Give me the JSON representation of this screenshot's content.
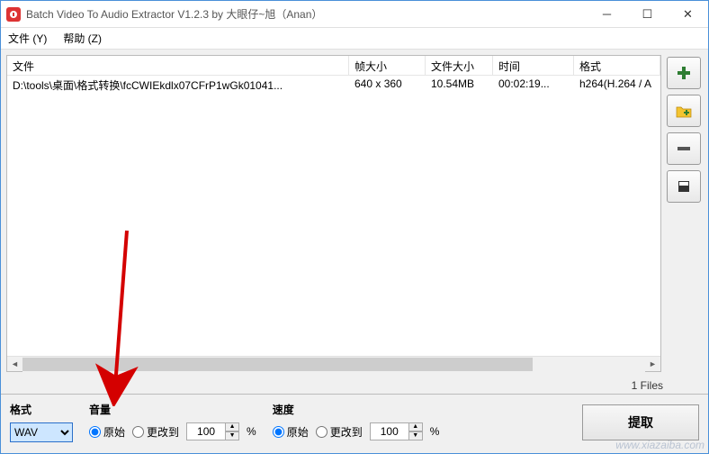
{
  "window": {
    "title": "Batch Video To Audio Extractor V1.2.3 by 大眼仔~旭（Anan）"
  },
  "menu": {
    "file": "文件 (Y)",
    "help": "帮助 (Z)"
  },
  "table": {
    "headers": {
      "file": "文件",
      "frame_size": "帧大小",
      "file_size": "文件大小",
      "time": "时间",
      "format": "格式"
    },
    "rows": [
      {
        "file": "D:\\tools\\桌面\\格式转换\\fcCWIEkdlx07CFrP1wGk01041...",
        "frame_size": "640 x 360",
        "file_size": "10.54MB",
        "time": "00:02:19...",
        "format": "h264(H.264 / A"
      }
    ]
  },
  "status": {
    "files_count": "1 Files"
  },
  "bottom": {
    "format_label": "格式",
    "format_value": "WAV",
    "volume_label": "音量",
    "speed_label": "速度",
    "radio_original": "原始",
    "radio_change_to": "更改到",
    "spin_value": "100",
    "percent": "%",
    "extract": "提取"
  },
  "watermark": "www.xiazaiba.com"
}
